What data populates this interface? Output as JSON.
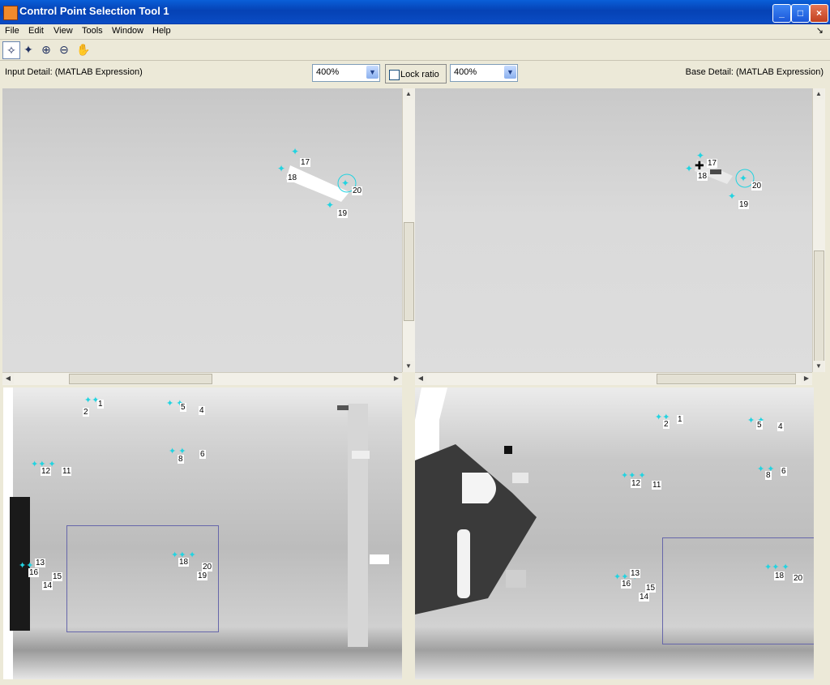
{
  "window": {
    "title": "Control Point Selection Tool 1"
  },
  "menu": [
    "File",
    "Edit",
    "View",
    "Tools",
    "Window",
    "Help"
  ],
  "details": {
    "input": "Input Detail: (MATLAB Expression)",
    "base": "Base Detail: (MATLAB Expression)"
  },
  "zoom": {
    "input": "400%",
    "base": "400%"
  },
  "lock_ratio": "Lock ratio",
  "points_detail_input": [
    "17",
    "18",
    "20",
    "19"
  ],
  "points_detail_base": [
    "17",
    "18",
    "20",
    "19"
  ],
  "points_overview_input": [
    "1",
    "2",
    "5",
    "4",
    "6",
    "8",
    "12",
    "11",
    "13",
    "16",
    "15",
    "14",
    "18",
    "20",
    "19"
  ],
  "points_overview_base": [
    "2",
    "1",
    "5",
    "4",
    "6",
    "8",
    "12",
    "11",
    "13",
    "16",
    "15",
    "14",
    "18",
    "20"
  ]
}
